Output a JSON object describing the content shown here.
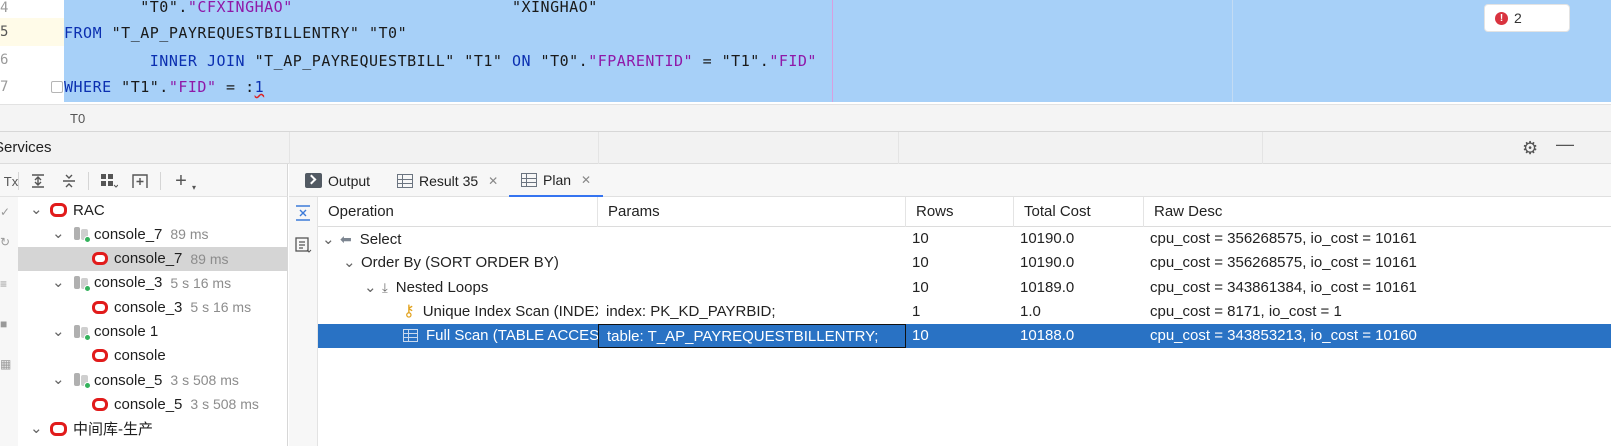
{
  "editor": {
    "line_numbers": [
      "4",
      "5",
      "6",
      "7"
    ],
    "lines": [
      {
        "indent": "        ",
        "parts": [
          {
            "t": "\"T0\".",
            "c": "str"
          },
          {
            "t": "\"CFXINGHAO\"",
            "c": "fld"
          },
          {
            "t": "                       \"XINGHAO\"",
            "c": "str"
          }
        ]
      },
      {
        "indent": "",
        "parts": [
          {
            "t": "FROM",
            "c": "kw"
          },
          {
            "t": " \"T_AP_PAYREQUESTBILLENTRY\" \"T0\"",
            "c": "str"
          }
        ]
      },
      {
        "indent": "         ",
        "parts": [
          {
            "t": "INNER JOIN",
            "c": "kw"
          },
          {
            "t": " \"T_AP_PAYREQUESTBILL\" \"T1\" ",
            "c": "str"
          },
          {
            "t": "ON",
            "c": "kw"
          },
          {
            "t": " \"T0\".",
            "c": "str"
          },
          {
            "t": "\"FPARENTID\"",
            "c": "fld"
          },
          {
            "t": " = \"T1\".",
            "c": "str"
          },
          {
            "t": "\"FID\"",
            "c": "fld"
          }
        ]
      },
      {
        "indent": "",
        "parts": [
          {
            "t": "WHERE",
            "c": "kw"
          },
          {
            "t": " \"T1\".",
            "c": "str"
          },
          {
            "t": "\"FID\"",
            "c": "fld"
          },
          {
            "t": " = :",
            "c": "str"
          },
          {
            "t": "1",
            "c": "prm"
          }
        ]
      }
    ],
    "error_count": "2",
    "breadcrumb": "T0"
  },
  "services": {
    "title": "Services"
  },
  "tree": [
    {
      "label": "RAC",
      "time": "",
      "type": "oracle-root",
      "expanded": true,
      "depth": 0
    },
    {
      "label": "console_7",
      "time": "89 ms",
      "type": "session",
      "expanded": true,
      "depth": 1
    },
    {
      "label": "console_7",
      "time": "89 ms",
      "type": "console",
      "depth": 2,
      "selected": true
    },
    {
      "label": "console_3",
      "time": "5 s 16 ms",
      "type": "session",
      "expanded": true,
      "depth": 1
    },
    {
      "label": "console_3",
      "time": "5 s 16 ms",
      "type": "console",
      "depth": 2
    },
    {
      "label": "console 1",
      "time": "",
      "type": "session",
      "expanded": true,
      "depth": 1
    },
    {
      "label": "console",
      "time": "",
      "type": "console",
      "depth": 2
    },
    {
      "label": "console_5",
      "time": "3 s 508 ms",
      "type": "session",
      "expanded": true,
      "depth": 1
    },
    {
      "label": "console_5",
      "time": "3 s 508 ms",
      "type": "console",
      "depth": 2
    },
    {
      "label": "中间库-生产",
      "time": "",
      "type": "oracle-root",
      "expanded": true,
      "depth": 0
    }
  ],
  "tabs": [
    {
      "label": "Output",
      "icon": "output-icon",
      "closable": false
    },
    {
      "label": "Result 35",
      "icon": "grid-icon",
      "closable": true
    },
    {
      "label": "Plan",
      "icon": "grid-icon",
      "closable": true,
      "active": true
    }
  ],
  "plan": {
    "columns": [
      "Operation",
      "Params",
      "Rows",
      "Total Cost",
      "Raw Desc"
    ],
    "rows": [
      {
        "operation": "Select",
        "params": "",
        "rows": "10",
        "cost": "10190.0",
        "desc": "cpu_cost = 356268575, io_cost = 10161",
        "icon": "select-icon",
        "level": 0,
        "chevron": true
      },
      {
        "operation": "Order By (SORT ORDER BY)",
        "params": "",
        "rows": "10",
        "cost": "10190.0",
        "desc": "cpu_cost = 356268575, io_cost = 10161",
        "icon": "",
        "level": 1,
        "chevron": true
      },
      {
        "operation": "Nested Loops",
        "params": "",
        "rows": "10",
        "cost": "10189.0",
        "desc": "cpu_cost = 343861384, io_cost = 10161",
        "icon": "nested-loops-icon",
        "level": 2,
        "chevron": true
      },
      {
        "operation": "Unique Index Scan (INDEX UNIQUE SCAN)",
        "params": "index: PK_KD_PAYRBID;",
        "rows": "1",
        "cost": "1.0",
        "desc": "cpu_cost = 8171, io_cost = 1",
        "icon": "key-icon",
        "level": 3,
        "chevron": false
      },
      {
        "operation": "Full Scan (TABLE ACCESS FULL)",
        "params": "table: T_AP_PAYREQUESTBILLENTRY;",
        "rows": "10",
        "cost": "10188.0",
        "desc": "cpu_cost = 343853213, io_cost = 10160",
        "icon": "table-icon",
        "level": 3,
        "chevron": false,
        "selected": true
      }
    ]
  }
}
